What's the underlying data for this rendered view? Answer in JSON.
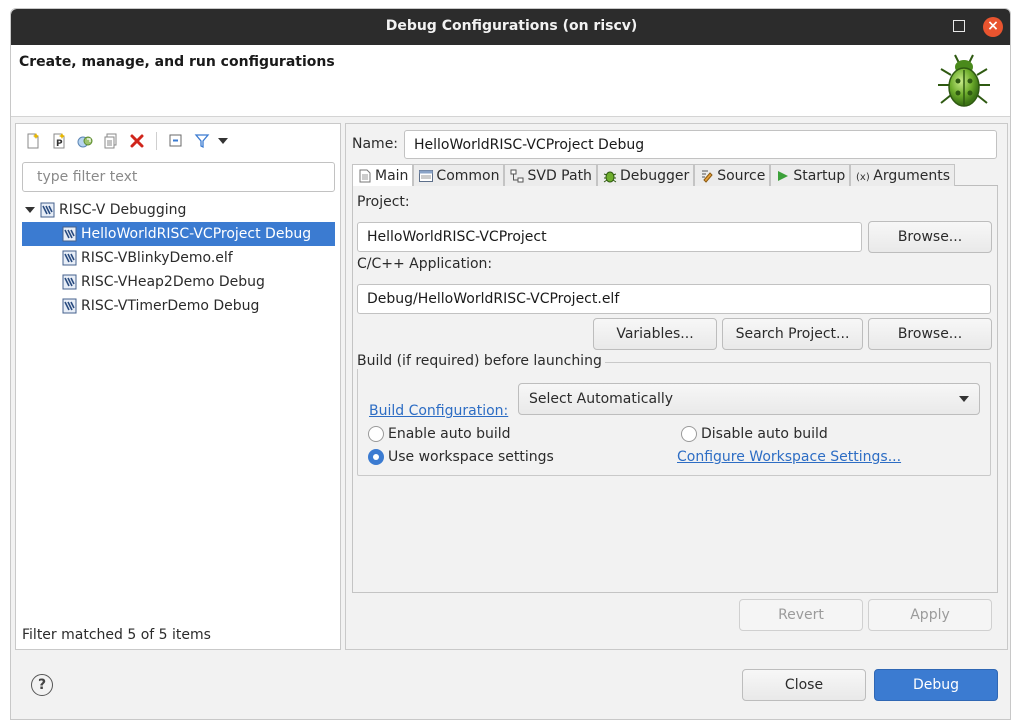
{
  "window": {
    "title": "Debug Configurations  (on riscv)",
    "close_glyph": "×"
  },
  "banner": {
    "heading": "Create, manage, and run configurations",
    "icon": "debug-bug-icon"
  },
  "left": {
    "toolbar": [
      {
        "name": "new-configuration-icon",
        "tooltip": ""
      },
      {
        "name": "new-prototype-icon",
        "tooltip": ""
      },
      {
        "name": "export-configuration-icon",
        "tooltip": ""
      },
      {
        "name": "duplicate-configuration-icon",
        "tooltip": ""
      },
      {
        "name": "delete-configuration-icon",
        "tooltip": ""
      },
      {
        "name": "collapse-all-icon",
        "tooltip": ""
      },
      {
        "name": "filter-icon",
        "tooltip": ""
      },
      {
        "name": "view-menu-icon",
        "tooltip": ""
      }
    ],
    "filter_placeholder": "type filter text",
    "tree": {
      "root": "RISC-V Debugging",
      "items": [
        {
          "label": "HelloWorldRISC-VCProject Debug",
          "selected": true
        },
        {
          "label": "RISC-VBlinkyDemo.elf",
          "selected": false
        },
        {
          "label": "RISC-VHeap2Demo Debug",
          "selected": false
        },
        {
          "label": "RISC-VTimerDemo Debug",
          "selected": false
        }
      ]
    },
    "filter_status": "Filter matched 5 of 5 items"
  },
  "right": {
    "name_label": "Name:",
    "name_value": "HelloWorldRISC-VCProject Debug",
    "tabs": [
      {
        "label": "Main",
        "icon": "main-tab-icon",
        "active": true
      },
      {
        "label": "Common",
        "icon": "common-tab-icon",
        "active": false
      },
      {
        "label": "SVD Path",
        "icon": "svd-path-tab-icon",
        "active": false
      },
      {
        "label": "Debugger",
        "icon": "debugger-tab-icon",
        "active": false
      },
      {
        "label": "Source",
        "icon": "source-tab-icon",
        "active": false
      },
      {
        "label": "Startup",
        "icon": "startup-tab-icon",
        "active": false
      },
      {
        "label": "Arguments",
        "icon": "arguments-tab-icon",
        "active": false
      }
    ],
    "project_label": "Project:",
    "project_value": "HelloWorldRISC-VCProject",
    "browse_label": "Browse...",
    "app_label": "C/C++ Application:",
    "app_value": "Debug/HelloWorldRISC-VCProject.elf",
    "variables_label": "Variables...",
    "search_project_label": "Search Project...",
    "browse2_label": "Browse...",
    "build_group_title": "Build (if required) before launching",
    "build_config_link": "Build Configuration:",
    "build_config_value": "Select Automatically",
    "radios": {
      "enable_auto": "Enable auto build",
      "disable_auto": "Disable auto build",
      "use_workspace": "Use workspace settings",
      "selected": "use_workspace"
    },
    "configure_ws_link": "Configure Workspace Settings...",
    "revert_label": "Revert",
    "apply_label": "Apply"
  },
  "footer": {
    "help_glyph": "?",
    "close_label": "Close",
    "debug_label": "Debug"
  },
  "colors": {
    "accent": "#3b7bd1",
    "link": "#2d6dc4",
    "titlebar": "#2c2c2c",
    "close_button": "#e9542f",
    "delete_icon": "#d0251b"
  }
}
